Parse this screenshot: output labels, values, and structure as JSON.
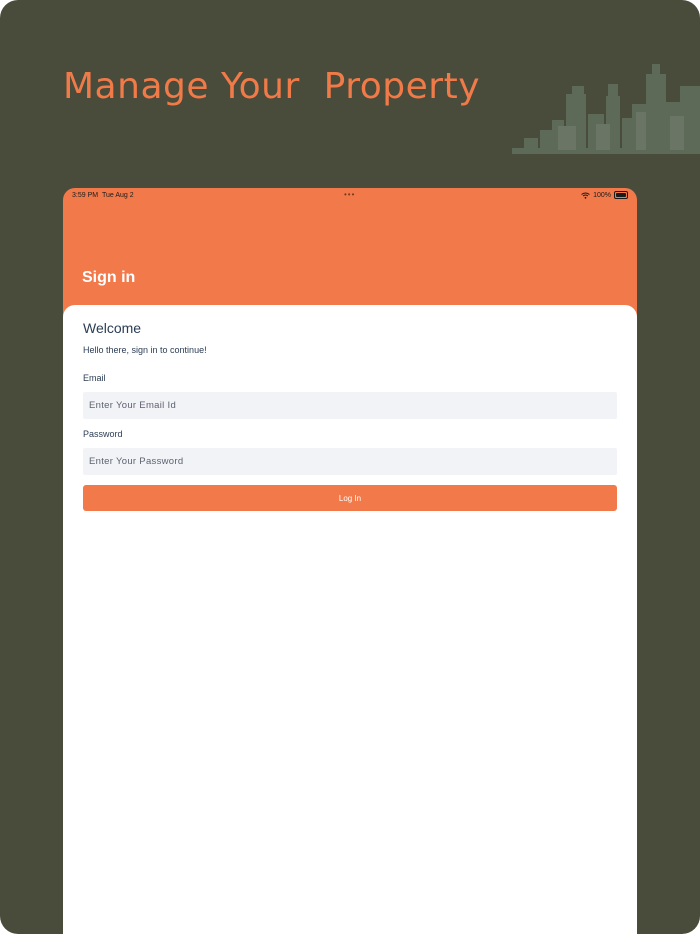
{
  "marketing": {
    "headline": "Manage Your  Property"
  },
  "status_bar": {
    "time": "3:59 PM",
    "date": "Tue Aug 2",
    "battery": "100%",
    "dots": "•••"
  },
  "nav": {
    "title": "Sign in"
  },
  "form": {
    "welcome": "Welcome",
    "subtitle": "Hello there, sign in to continue!",
    "email_label": "Email",
    "email_placeholder": "Enter Your Email Id",
    "email_value": "",
    "password_label": "Password",
    "password_placeholder": "Enter Your Password",
    "password_value": "",
    "login_label": "Log In"
  },
  "colors": {
    "background": "#4a4c3b",
    "accent": "#f27a4a",
    "text": "#2b3d55",
    "input_bg": "#f2f3f7"
  }
}
